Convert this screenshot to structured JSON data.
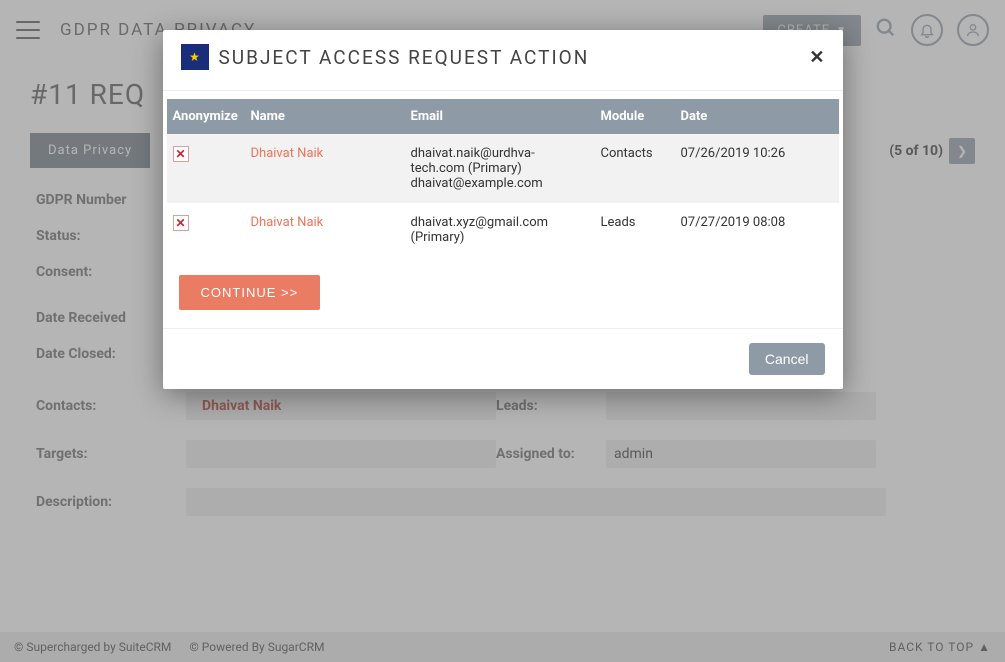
{
  "header": {
    "brand": "GDPR DATA PRIVACY",
    "create_label": "CREATE"
  },
  "page_title": "#11 REQ",
  "tab": {
    "label": "Data Privacy"
  },
  "pager": {
    "text": "(5 of 10)"
  },
  "form": {
    "gdpr_number_label": "GDPR Number",
    "status_label": "Status:",
    "consent_label": "Consent:",
    "date_received_label": "Date Received",
    "date_closed_label": "Date Closed:",
    "contacts_label": "Contacts:",
    "contacts_value": "Dhaivat Naik",
    "leads_label": "Leads:",
    "targets_label": "Targets:",
    "assigned_to_label": "Assigned to:",
    "assigned_to_value": "admin",
    "description_label": "Description:"
  },
  "footer": {
    "left1": "© Supercharged by SuiteCRM",
    "left2": "© Powered By SugarCRM",
    "right": "BACK TO TOP"
  },
  "modal": {
    "title": "SUBJECT ACCESS REQUEST ACTION",
    "columns": {
      "anon": "Anonymize",
      "name": "Name",
      "email": "Email",
      "module": "Module",
      "date": "Date"
    },
    "rows": [
      {
        "name": "Dhaivat Naik",
        "email_line1": "dhaivat.naik@urdhva-tech.com (Primary)",
        "email_line2": "dhaivat@example.com",
        "module": "Contacts",
        "date": "07/26/2019 10:26"
      },
      {
        "name": "Dhaivat Naik",
        "email_line1": "dhaivat.xyz@gmail.com (Primary)",
        "email_line2": "",
        "module": "Leads",
        "date": "07/27/2019 08:08"
      }
    ],
    "continue_label": "CONTINUE >>",
    "cancel_label": "Cancel"
  }
}
